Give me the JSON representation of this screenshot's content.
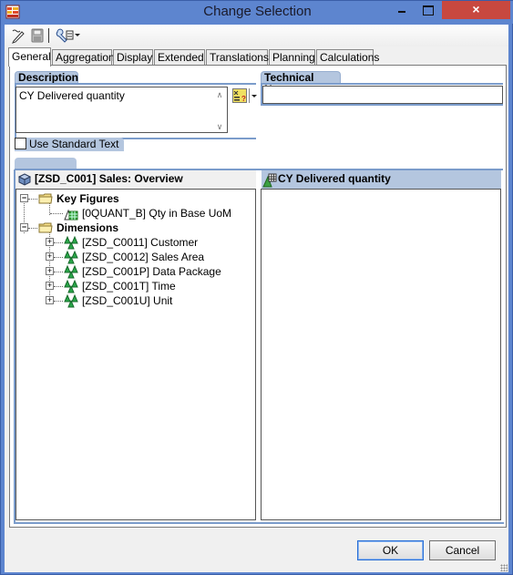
{
  "window": {
    "title": "Change Selection",
    "close_label": "×"
  },
  "toolbar": {
    "icons": [
      "edit-icon",
      "save-icon",
      "tools-icon"
    ]
  },
  "tabs": [
    {
      "label": "General",
      "active": true
    },
    {
      "label": "Aggregation",
      "active": false
    },
    {
      "label": "Display",
      "active": false
    },
    {
      "label": "Extended",
      "active": false
    },
    {
      "label": "Translations",
      "active": false
    },
    {
      "label": "Planning",
      "active": false
    },
    {
      "label": "Calculations",
      "active": false
    }
  ],
  "general": {
    "description_label": "Description",
    "description_value": "CY Delivered quantity",
    "technical_name_label": "Technical Name",
    "technical_name_value": "",
    "use_standard_text_label": "Use Standard Text",
    "use_standard_text_checked": false
  },
  "left_pane": {
    "title": "[ZSD_C001] Sales: Overview",
    "tree": {
      "key_figures": {
        "label": "Key Figures",
        "items": [
          "[0QUANT_B] Qty in Base UoM"
        ]
      },
      "dimensions": {
        "label": "Dimensions",
        "items": [
          "[ZSD_C0011] Customer",
          "[ZSD_C0012] Sales Area",
          "[ZSD_C001P] Data Package",
          "[ZSD_C001T] Time",
          "[ZSD_C001U] Unit"
        ]
      }
    }
  },
  "right_pane": {
    "title": "CY Delivered quantity"
  },
  "buttons": {
    "ok": "OK",
    "cancel": "Cancel"
  }
}
